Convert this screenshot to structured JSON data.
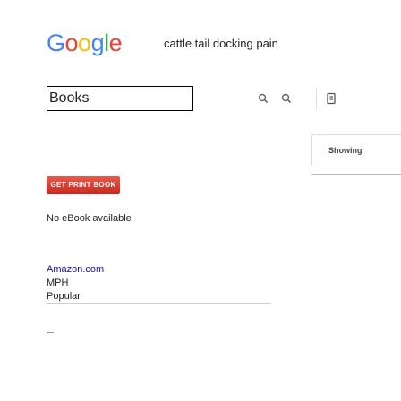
{
  "logo": {
    "letters": [
      "G",
      "o",
      "o",
      "g",
      "l",
      "e"
    ],
    "colors": [
      "#4285f4",
      "#ea4335",
      "#fbbc05",
      "#4285f4",
      "#34a853",
      "#ea4335"
    ]
  },
  "search": {
    "value": "cattle tail docking pain"
  },
  "tab": {
    "label": "Books"
  },
  "toolbar": {
    "icons": [
      "search-icon",
      "zoom-out-icon",
      "bookmark-icon"
    ]
  },
  "showing": {
    "label": "Showing"
  },
  "print_button": {
    "label": "GET PRINT BOOK"
  },
  "ebook": {
    "status": "No eBook available"
  },
  "retailers": [
    "Amazon.com",
    "MPH",
    "Popular"
  ],
  "accent": "#c8281e",
  "link_color": "#1a0dab"
}
